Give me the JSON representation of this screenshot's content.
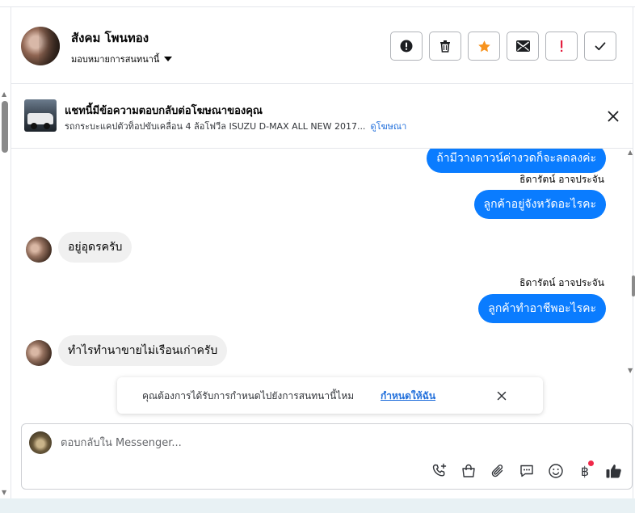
{
  "header": {
    "contact_name": "สังคม โพนทอง",
    "assign_label": "มอบหมายการสนทนานี้",
    "toolbar": [
      {
        "name": "report-icon"
      },
      {
        "name": "trash-icon"
      },
      {
        "name": "star-icon"
      },
      {
        "name": "mail-icon"
      },
      {
        "name": "follow-up-icon"
      },
      {
        "name": "check-icon"
      }
    ]
  },
  "ad_banner": {
    "title": "แชทนี้มีข้อความตอบกลับต่อโฆษณาของคุณ",
    "subtitle": "รถกระบะแคปตัวท็อปขับเคลื่อน 4 ล้อโฟวีล ISUZU D-MAX ALL NEW 2017...",
    "link": "ดูโฆษณา"
  },
  "messages": [
    {
      "direction": "out",
      "text": "ถ้ามีวางดาวน์ค่างวดก็จะลดลงค่ะ"
    },
    {
      "direction": "out",
      "sender": "ธิดารัตน์ อาจประจัน",
      "text": "ลูกค้าอยู่จังหวัดอะไรคะ"
    },
    {
      "direction": "in",
      "text": "อยู่อุดรครับ"
    },
    {
      "direction": "out",
      "sender": "ธิดารัตน์ อาจประจัน",
      "text": "ลูกค้าทำอาชีพอะไรคะ"
    },
    {
      "direction": "in",
      "text": "ทำไรทำนาขายไม่เรือนเก่าครับ"
    }
  ],
  "assign_prompt": {
    "text": "คุณต้องการได้รับการกำหนดไปยังการสนทนานี้ไหม",
    "link": "กำหนดให้ฉัน"
  },
  "composer": {
    "placeholder": "ตอบกลับใน Messenger...",
    "currency_symbol": "฿",
    "colors": {
      "badge": "#f02849",
      "accent": "#0a7cff"
    }
  },
  "colors": {
    "outgoing_bubble": "#0a7cff",
    "incoming_bubble": "#f0f0f0",
    "star": "#f7931e",
    "alert": "#e41e3f",
    "link": "#216fdb"
  }
}
